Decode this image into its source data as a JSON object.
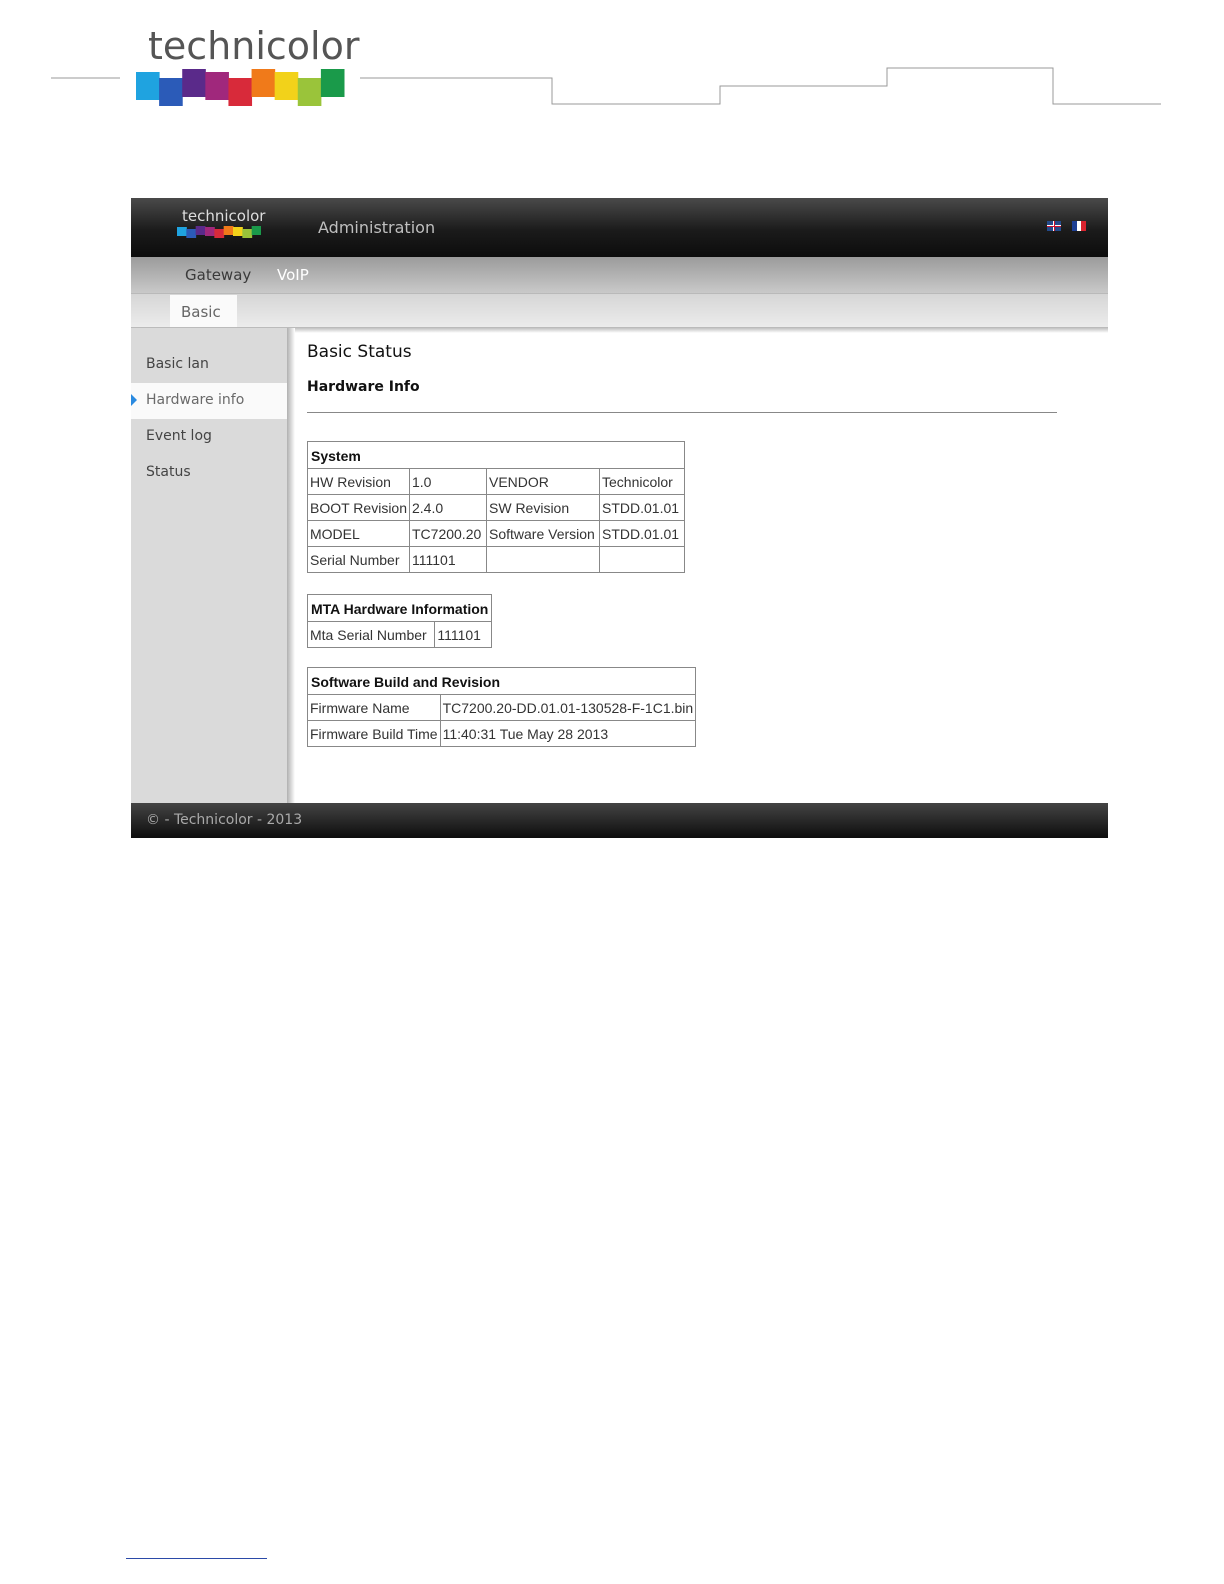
{
  "doc": {
    "brand": "technicolor"
  },
  "app": {
    "brand": "technicolor",
    "title": "Administration",
    "languages": [
      {
        "name": "uk-flag-icon"
      },
      {
        "name": "fr-flag-icon"
      }
    ]
  },
  "nav": {
    "tabs": [
      {
        "label": "Gateway"
      },
      {
        "label": "VoIP",
        "active": true
      }
    ],
    "subtabs": [
      {
        "label": "Basic",
        "active": true
      }
    ]
  },
  "sidebar": {
    "items": [
      {
        "label": "Basic lan"
      },
      {
        "label": "Hardware info",
        "active": true
      },
      {
        "label": "Event log"
      },
      {
        "label": "Status"
      }
    ]
  },
  "main": {
    "title": "Basic Status",
    "section": "Hardware Info",
    "system": {
      "header": "System",
      "rows": [
        [
          "HW Revision",
          "1.0",
          "VENDOR",
          "Technicolor"
        ],
        [
          "BOOT Revision",
          "2.4.0",
          "SW Revision",
          "STDD.01.01"
        ],
        [
          "MODEL",
          "TC7200.20",
          "Software Version",
          "STDD.01.01"
        ],
        [
          "Serial Number",
          "111101",
          "",
          ""
        ]
      ]
    },
    "mta": {
      "header": "MTA Hardware Information",
      "rows": [
        [
          "Mta Serial Number",
          "111101"
        ]
      ]
    },
    "software": {
      "header": "Software Build and Revision",
      "rows": [
        [
          "Firmware Name",
          "TC7200.20-DD.01.01-130528-F-1C1.bin"
        ],
        [
          "Firmware Build Time",
          "11:40:31 Tue May 28 2013"
        ]
      ]
    }
  },
  "footer": {
    "copyright": "© - Technicolor - 2013"
  },
  "colors": {
    "accent_arrow": "#2a8ae0",
    "logo_bars": [
      "#1fa3e0",
      "#2b5bb8",
      "#5a2a8a",
      "#a0287c",
      "#d82a3a",
      "#f07a1a",
      "#f2d21a",
      "#9ac43a",
      "#1a9a4a"
    ]
  }
}
